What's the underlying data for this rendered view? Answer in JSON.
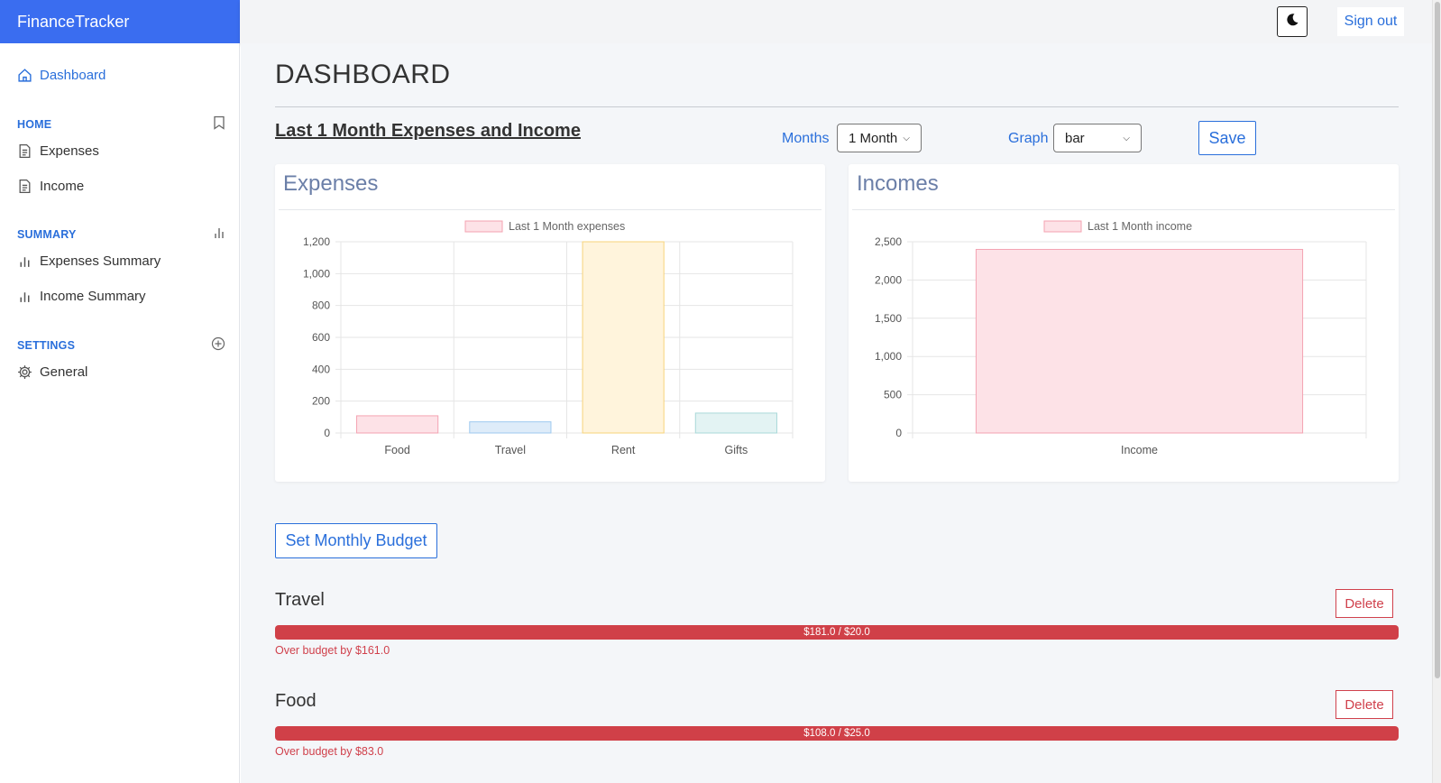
{
  "app": {
    "brand": "FinanceTracker",
    "sign_out": "Sign out"
  },
  "sidebar": {
    "dashboard": "Dashboard",
    "home_heading": "HOME",
    "expenses": "Expenses",
    "income": "Income",
    "summary_heading": "SUMMARY",
    "expenses_summary": "Expenses Summary",
    "income_summary": "Income Summary",
    "settings_heading": "SETTINGS",
    "general": "General"
  },
  "main": {
    "title": "DASHBOARD",
    "section_title": "Last 1 Month Expenses and Income",
    "months_label": "Months",
    "months_value": "1 Month",
    "graph_label": "Graph",
    "graph_value": "bar",
    "save": "Save",
    "set_budget": "Set Monthly Budget"
  },
  "chart_data": [
    {
      "type": "bar",
      "card_title": "Expenses",
      "legend": "Last 1 Month expenses",
      "categories": [
        "Food",
        "Travel",
        "Rent",
        "Gifts"
      ],
      "values": [
        108,
        70,
        1200,
        125
      ],
      "colors": [
        "#f4a3b2",
        "#9ec9ef",
        "#f7d37a",
        "#a9d9d9"
      ],
      "fills": [
        "#fde2e7",
        "#deecf9",
        "#fff4dc",
        "#e3f3f3"
      ],
      "yticks": [
        0,
        200,
        400,
        600,
        800,
        1000,
        1200
      ],
      "ylim": [
        0,
        1200
      ]
    },
    {
      "type": "bar",
      "card_title": "Incomes",
      "legend": "Last 1 Month income",
      "categories": [
        "Income"
      ],
      "values": [
        2400
      ],
      "colors": [
        "#f4a3b2"
      ],
      "fills": [
        "#fde2e7"
      ],
      "yticks": [
        0,
        500,
        1000,
        1500,
        2000,
        2500
      ],
      "ylim": [
        0,
        2500
      ]
    }
  ],
  "budgets": [
    {
      "name": "Travel",
      "delete": "Delete",
      "progress_text": "$181.0 / $20.0",
      "spent": 181.0,
      "limit": 20.0,
      "over_text": "Over budget by $161.0"
    },
    {
      "name": "Food",
      "delete": "Delete",
      "progress_text": "$108.0 / $25.0",
      "spent": 108.0,
      "limit": 25.0,
      "over_text": "Over budget by $83.0"
    }
  ],
  "colors": {
    "brand": "#3a6df0",
    "accent": "#2a6fdb",
    "danger": "#d04048"
  }
}
